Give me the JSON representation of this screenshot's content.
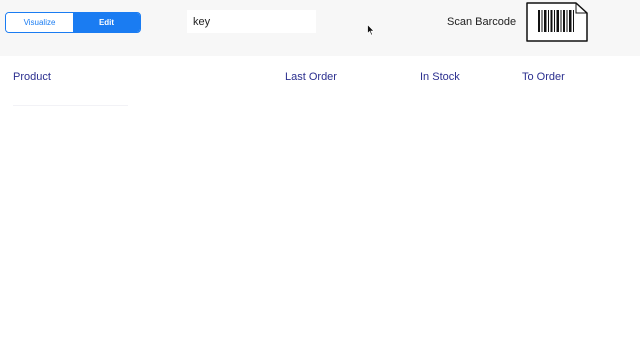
{
  "toolbar": {
    "segments": [
      "Visualize",
      "Edit"
    ],
    "active_segment": "Edit",
    "search": {
      "value": "key",
      "placeholder": ""
    },
    "scan_label": "Scan Barcode",
    "barcode_icon": "barcode-icon",
    "accent_color": "#1a7cf2"
  },
  "table": {
    "columns": [
      "Product",
      "Last Order",
      "In Stock",
      "To Order"
    ],
    "header_color": "#2b2f8f",
    "rows": []
  }
}
